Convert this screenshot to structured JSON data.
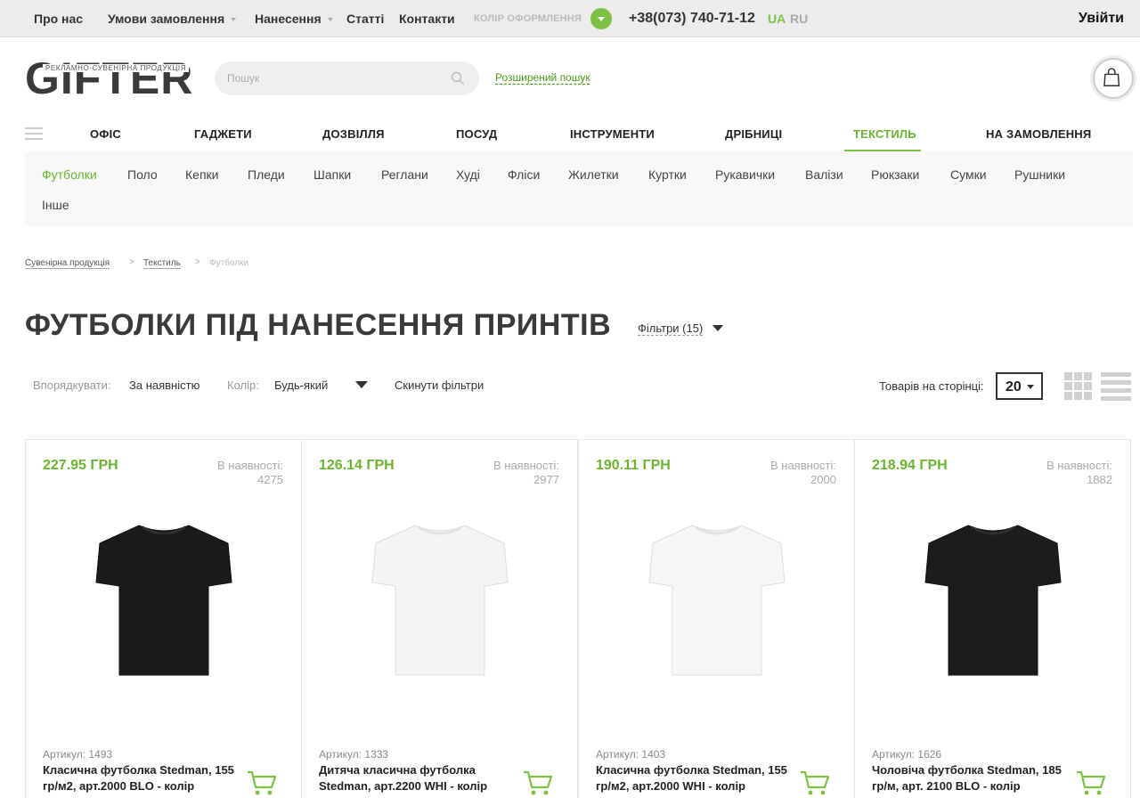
{
  "topbar": {
    "links": [
      "Про нас",
      "Умови замовлення",
      "Нанесення",
      "Статті",
      "Контакти"
    ],
    "color_label": "КОЛІР ОФОРМЛЕННЯ",
    "phone": "+38(073) 740-71-12",
    "lang_ua": "UA",
    "lang_ru": "RU",
    "login": "Увійти"
  },
  "logo": {
    "text": "GIFTER",
    "subtitle": "РЕКЛАМНО-СУВЕНІРНА ПРОДУКЦІЯ"
  },
  "search": {
    "placeholder": "Пошук",
    "advanced": "Розширений пошук"
  },
  "categories": [
    "ОФІС",
    "ГАДЖЕТИ",
    "ДОЗВІЛЛЯ",
    "ПОСУД",
    "ІНСТРУМЕНТИ",
    "ДРІБНИЦІ",
    "ТЕКСТИЛЬ",
    "НА ЗАМОВЛЕННЯ"
  ],
  "subcategories": [
    "Футболки",
    "Поло",
    "Кепки",
    "Пледи",
    "Шапки",
    "Реглани",
    "Худі",
    "Фліси",
    "Жилетки",
    "Куртки",
    "Рукавички",
    "Валізи",
    "Рюкзаки",
    "Сумки",
    "Рушники",
    "Інше"
  ],
  "breadcrumb": [
    "Сувенірна продукція",
    "Текстиль",
    "Футболки"
  ],
  "breadcrumb_sep": ">",
  "title": "ФУТБОЛКИ ПІД НАНЕСЕННЯ ПРИНТІВ",
  "filters_toggle": "Фільтри (15)",
  "sort": {
    "sort_label": "Впорядкувати:",
    "sort_value": "За наявністю",
    "color_label": "Колір:",
    "color_value": "Будь-який",
    "reset": "Скинути фільтри",
    "per_page_label": "Товарів на сторінці:",
    "per_page_value": "20"
  },
  "colors": {
    "accent": "#7dc242",
    "price": "#6bb52e",
    "text": "#222222"
  },
  "products": [
    {
      "price": "227.95 ГРН",
      "stock_label": "В наявності:",
      "stock": "4275",
      "article": "Артикул: 1493",
      "name": "Класична футболка Stedman, 155 гр/м2, арт.2000 BLO - колір",
      "shirt_color": "#1a1a1a"
    },
    {
      "price": "126.14 ГРН",
      "stock_label": "В наявності:",
      "stock": "2977",
      "article": "Артикул: 1333",
      "name": "Дитяча класична футболка Stedman, арт.2200 WHI - колір",
      "shirt_color": "#f4f4f4"
    },
    {
      "price": "190.11 ГРН",
      "stock_label": "В наявності:",
      "stock": "2000",
      "article": "Артикул: 1403",
      "name": "Класична футболка Stedman, 155 гр/м2, арт.2000 WHI - колір",
      "shirt_color": "#f6f6f6"
    },
    {
      "price": "218.94 ГРН",
      "stock_label": "В наявності:",
      "stock": "1882",
      "article": "Артикул: 1626",
      "name": "Чоловіча футболка Stedman, 185 гр/м, арт. 2100 BLO - колір",
      "shirt_color": "#1c1c1c"
    }
  ]
}
